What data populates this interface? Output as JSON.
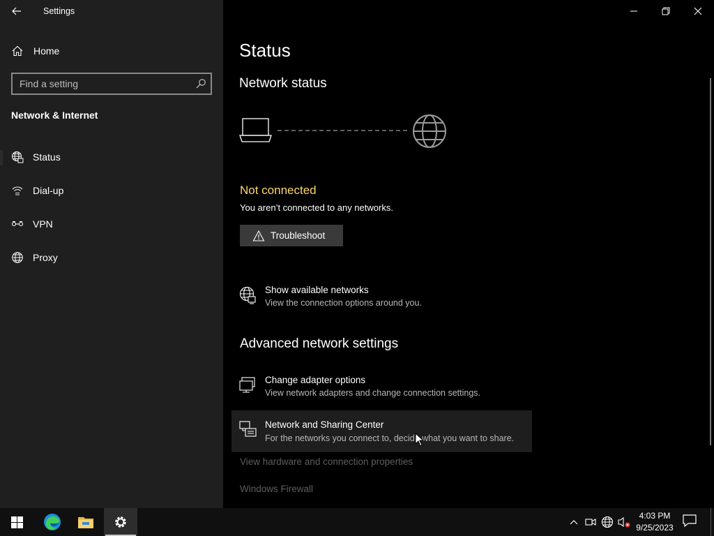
{
  "window": {
    "app_title": "Settings"
  },
  "sidebar": {
    "home_label": "Home",
    "search_placeholder": "Find a setting",
    "section_title": "Network & Internet",
    "items": [
      {
        "label": "Status",
        "icon": "globe-network-icon",
        "selected": true
      },
      {
        "label": "Dial-up",
        "icon": "dial-up-icon",
        "selected": false
      },
      {
        "label": "VPN",
        "icon": "vpn-icon",
        "selected": false
      },
      {
        "label": "Proxy",
        "icon": "globe-icon",
        "selected": false
      }
    ]
  },
  "main": {
    "page_title": "Status",
    "network_status_heading": "Network status",
    "status_title": "Not connected",
    "status_description": "You aren’t connected to any networks.",
    "troubleshoot_label": "Troubleshoot",
    "show_networks": {
      "title": "Show available networks",
      "description": "View the connection options around you."
    },
    "advanced_heading": "Advanced network settings",
    "advanced_links": [
      {
        "title": "Change adapter options",
        "description": "View network adapters and change connection settings."
      },
      {
        "title": "Network and Sharing Center",
        "description": "For the networks you connect to, decide what you want to share."
      }
    ],
    "faded_links": [
      "View hardware and connection properties",
      "Windows Firewall"
    ]
  },
  "taskbar": {
    "apps": [
      "start-icon",
      "edge-icon",
      "file-explorer-icon",
      "settings-icon"
    ],
    "time": "4:03 PM",
    "date": "9/25/2023"
  },
  "colors": {
    "status_warning": "#ffd96a",
    "sidebar_bg": "#1f1f1f",
    "main_bg": "#000000",
    "button_bg": "#3a3a3a"
  }
}
